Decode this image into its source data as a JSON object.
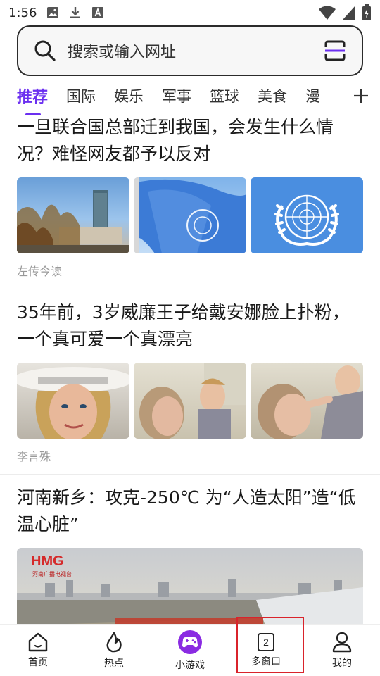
{
  "status_bar": {
    "time": "1:56"
  },
  "search": {
    "placeholder": "搜索或输入网址"
  },
  "tabs": [
    {
      "label": "推荐",
      "active": true
    },
    {
      "label": "国际"
    },
    {
      "label": "娱乐"
    },
    {
      "label": "军事"
    },
    {
      "label": "篮球"
    },
    {
      "label": "美食"
    },
    {
      "label": "漫"
    }
  ],
  "articles": [
    {
      "title": "一旦联合国总部迁到我国，会发生什么情况？难怪网友都予以反对",
      "source": "左传今读"
    },
    {
      "title": "35年前，3岁威廉王子给戴安娜脸上扑粉，一个真可爱一个真漂亮",
      "source": "李言殊"
    },
    {
      "title": "河南新乡：攻克-250℃ 为“人造太阳”造“低温心脏”",
      "source": "",
      "image_logo": "HMG",
      "image_sublogo": "河南广播电视台"
    }
  ],
  "bottom_nav": [
    {
      "label": "首页",
      "icon": "home-icon"
    },
    {
      "label": "热点",
      "icon": "flame-icon"
    },
    {
      "label": "小游戏",
      "icon": "gamepad-icon"
    },
    {
      "label": "多窗口",
      "icon": "window-count-icon",
      "count": "2"
    },
    {
      "label": "我的",
      "icon": "person-icon"
    }
  ],
  "colors": {
    "accent": "#6b2ff0",
    "highlight_box": "#d9232b"
  }
}
